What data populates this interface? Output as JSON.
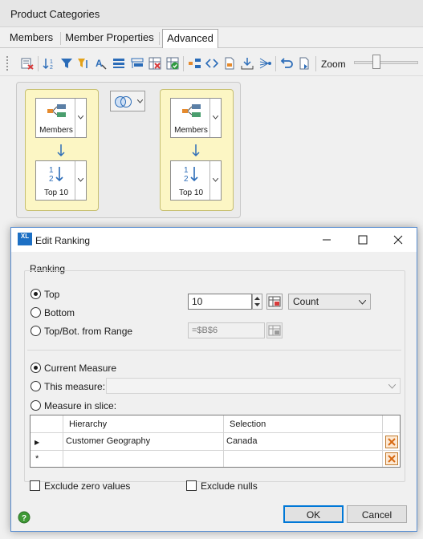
{
  "background_window": {
    "title": "Product Categories",
    "tabs": [
      {
        "label": "Members"
      },
      {
        "label": "Member Properties"
      },
      {
        "label": "Advanced",
        "active": true
      }
    ],
    "toolbar": {
      "zoom_label": "Zoom",
      "icons": [
        "clear-icon",
        "sort-icon",
        "filter-icon",
        "filter-clear-icon",
        "format-icon",
        "rows-icon",
        "hierarchy-icon",
        "remove-columns-icon",
        "validate-icon",
        "members-icon",
        "code-icon",
        "export-icon",
        "import-icon",
        "tree-icon",
        "undo-icon",
        "document-icon"
      ]
    },
    "flows": [
      {
        "source_label": "Members",
        "step_label": "Top 10"
      },
      {
        "source_label": "Members",
        "step_label": "Top 10"
      }
    ],
    "combine_button_icon": "venn-icon"
  },
  "dialog": {
    "title": "Edit Ranking",
    "logo_text": "XL",
    "section_label": "Ranking",
    "direction_options": [
      {
        "label": "Top",
        "selected": true
      },
      {
        "label": "Bottom",
        "selected": false
      },
      {
        "label": "Top/Bot. from Range",
        "selected": false
      }
    ],
    "n_value": "10",
    "aggregation": "Count",
    "range_value": "=$B$6",
    "measure_options": [
      {
        "label": "Current Measure",
        "selected": true
      },
      {
        "label": "This measure:",
        "selected": false
      },
      {
        "label": "Measure in slice:",
        "selected": false
      }
    ],
    "measure_value": "",
    "grid": {
      "columns": [
        "Hierarchy",
        "Selection"
      ],
      "rows": [
        {
          "marker": "▶",
          "hierarchy": "Customer Geography",
          "selection": "Canada"
        },
        {
          "marker": "*",
          "hierarchy": "",
          "selection": ""
        }
      ]
    },
    "checkboxes": [
      {
        "label": "Exclude zero values",
        "checked": false
      },
      {
        "label": "Exclude nulls",
        "checked": false
      }
    ],
    "buttons": {
      "ok": "OK",
      "cancel": "Cancel"
    }
  }
}
